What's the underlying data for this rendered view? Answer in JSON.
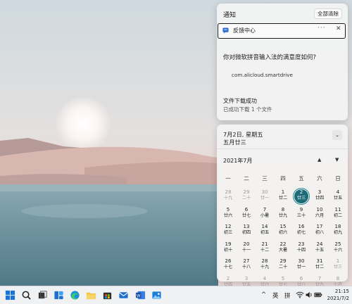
{
  "notifications": {
    "header_title": "通知",
    "clear_all_label": "全部清除",
    "feedback_card": {
      "title": "反馈中心",
      "more": "···",
      "close": "✕"
    },
    "feedback_question": "你对微软拼音输入法的满意度如何?",
    "package_name": "com.alicloud.smartdrive",
    "download": {
      "title": "文件下载成功",
      "subtitle": "已成功下载 1 个文件"
    }
  },
  "calendar": {
    "date_line": "7月2日, 星期五",
    "lunar_line": "五月廿三",
    "collapse_icon": "chevron-down-icon",
    "month_label": "2021年7月",
    "prev_icon": "▲",
    "next_icon": "▼",
    "weekdays": [
      "一",
      "二",
      "三",
      "四",
      "五",
      "六",
      "日"
    ],
    "weeks": [
      [
        {
          "n": "28",
          "l": "十九",
          "dim": true
        },
        {
          "n": "29",
          "l": "二十",
          "dim": true
        },
        {
          "n": "30",
          "l": "廿一",
          "dim": true
        },
        {
          "n": "1",
          "l": "廿二"
        },
        {
          "n": "2",
          "l": "廿三",
          "today": true
        },
        {
          "n": "3",
          "l": "廿四"
        },
        {
          "n": "4",
          "l": "廿五"
        }
      ],
      [
        {
          "n": "5",
          "l": "廿六"
        },
        {
          "n": "6",
          "l": "廿七"
        },
        {
          "n": "7",
          "l": "小暑"
        },
        {
          "n": "8",
          "l": "廿九"
        },
        {
          "n": "9",
          "l": "三十"
        },
        {
          "n": "10",
          "l": "六月"
        },
        {
          "n": "11",
          "l": "初二"
        }
      ],
      [
        {
          "n": "12",
          "l": "初三"
        },
        {
          "n": "13",
          "l": "初四"
        },
        {
          "n": "14",
          "l": "初五"
        },
        {
          "n": "15",
          "l": "初六"
        },
        {
          "n": "16",
          "l": "初七"
        },
        {
          "n": "17",
          "l": "初八"
        },
        {
          "n": "18",
          "l": "初九"
        }
      ],
      [
        {
          "n": "19",
          "l": "初十"
        },
        {
          "n": "20",
          "l": "十一"
        },
        {
          "n": "21",
          "l": "十二"
        },
        {
          "n": "22",
          "l": "大暑"
        },
        {
          "n": "23",
          "l": "十四"
        },
        {
          "n": "24",
          "l": "十五"
        },
        {
          "n": "25",
          "l": "十六"
        }
      ],
      [
        {
          "n": "26",
          "l": "十七"
        },
        {
          "n": "27",
          "l": "十八"
        },
        {
          "n": "28",
          "l": "十九"
        },
        {
          "n": "29",
          "l": "二十"
        },
        {
          "n": "30",
          "l": "廿一"
        },
        {
          "n": "31",
          "l": "廿二"
        },
        {
          "n": "1",
          "l": "廿三",
          "dim": true
        }
      ],
      [
        {
          "n": "2",
          "l": "廿四",
          "dim": true
        },
        {
          "n": "3",
          "l": "廿五",
          "dim": true
        },
        {
          "n": "4",
          "l": "廿六",
          "dim": true
        },
        {
          "n": "5",
          "l": "廿七",
          "dim": true
        },
        {
          "n": "6",
          "l": "廿八",
          "dim": true
        },
        {
          "n": "7",
          "l": "廿九",
          "dim": true
        },
        {
          "n": "8",
          "l": "七月",
          "dim": true
        }
      ]
    ]
  },
  "taskbar": {
    "icons": [
      "windows-start-icon",
      "search-icon",
      "task-view-icon",
      "widgets-icon",
      "edge-icon",
      "file-explorer-icon",
      "store-icon",
      "mail-icon",
      "word-icon",
      "photos-icon"
    ],
    "tray_chevron": "^",
    "ime_lang": "英",
    "ime_mode": "拼",
    "clock_time": "21:15",
    "clock_date": "2021/7/2"
  }
}
